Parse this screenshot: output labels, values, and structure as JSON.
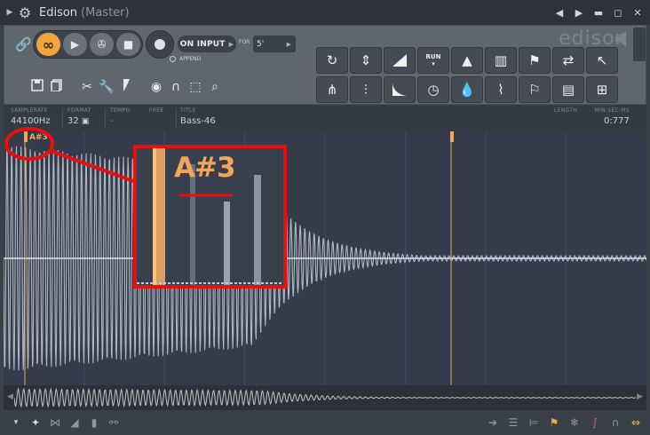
{
  "window": {
    "title": "Edison",
    "subtitle": "(Master)"
  },
  "toolbar": {
    "on_input_label": "ON INPUT",
    "for_label": "FOR",
    "for_value": "5'",
    "append_label": "APPEND",
    "logo": "edison",
    "run_label": "RUN"
  },
  "info": {
    "samplerate_label": "SAMPLERATE",
    "samplerate_value": "44100Hz",
    "format_label": "FORMAT",
    "format_value": "32",
    "tempo_label": "TEMPO",
    "tempo_value": "-",
    "free_label": "FREE",
    "title_label": "TITLE",
    "title_value": "Bass-46",
    "length_label": "LENGTH",
    "minsec_label": "MIN:SEC:MS",
    "minsec_value": "0:777"
  },
  "wave": {
    "marker_label": "A#3",
    "zoom_label": "A#3"
  },
  "colors": {
    "accent": "#f2a53c",
    "annotation": "#e80f0f",
    "wave": "#c8cdd8"
  },
  "icons": {
    "grid_row1": [
      "rotate-icon",
      "normalize-icon",
      "fade-in-icon",
      "run-icon",
      "blur-icon",
      "spectrum-icon",
      "marker-add-icon",
      "swap-icon",
      "cursor-icon"
    ],
    "grid_row2": [
      "tuning-fork-icon",
      "noise-icon",
      "fade-out-icon",
      "clock-icon",
      "drop-icon",
      "brush-icon",
      "slice-icon",
      "save-icon",
      "piano-roll-icon"
    ]
  }
}
